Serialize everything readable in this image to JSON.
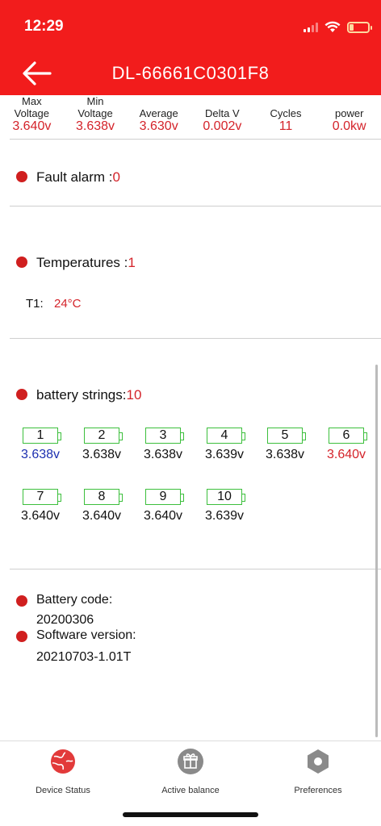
{
  "status_bar": {
    "time": "12:29"
  },
  "header": {
    "title": "DL-66661C0301F8"
  },
  "summary": [
    {
      "label": "Max\nVoltage",
      "value": "3.640v"
    },
    {
      "label": "Min\nVoltage",
      "value": "3.638v"
    },
    {
      "label": "Average",
      "value": "3.630v"
    },
    {
      "label": "Delta V",
      "value": "0.002v"
    },
    {
      "label": "Cycles",
      "value": "11"
    },
    {
      "label": "power",
      "value": "0.0kw"
    }
  ],
  "fault": {
    "label": "Fault alarm :",
    "value": "0"
  },
  "temperatures": {
    "label": "Temperatures :",
    "count": "1",
    "t1_label": "T1:",
    "t1_value": "24°C"
  },
  "battery_strings": {
    "label": "battery strings:",
    "count": "10",
    "cells": [
      {
        "num": "1",
        "voltage": "3.638v",
        "state": "low"
      },
      {
        "num": "2",
        "voltage": "3.638v",
        "state": "normal"
      },
      {
        "num": "3",
        "voltage": "3.638v",
        "state": "normal"
      },
      {
        "num": "4",
        "voltage": "3.639v",
        "state": "normal"
      },
      {
        "num": "5",
        "voltage": "3.638v",
        "state": "normal"
      },
      {
        "num": "6",
        "voltage": "3.640v",
        "state": "high"
      },
      {
        "num": "7",
        "voltage": "3.640v",
        "state": "normal"
      },
      {
        "num": "8",
        "voltage": "3.640v",
        "state": "normal"
      },
      {
        "num": "9",
        "voltage": "3.640v",
        "state": "normal"
      },
      {
        "num": "10",
        "voltage": "3.639v",
        "state": "normal"
      }
    ]
  },
  "info": {
    "battery_code_label": "Battery code:",
    "battery_code": "20200306",
    "software_version_label": "Software version:",
    "software_version": "20210703-1.01T"
  },
  "tabs": [
    {
      "label": "Device Status",
      "icon": "globe-icon",
      "color": "#e23a3a"
    },
    {
      "label": "Active balance",
      "icon": "gift-icon",
      "color": "#8a8a8a"
    },
    {
      "label": "Preferences",
      "icon": "gear-icon",
      "color": "#8a8a8a"
    }
  ],
  "colors": {
    "header": "#f21c1c",
    "accent_red": "#d4232a",
    "cell_border": "#3cbf3c",
    "low_voltage": "#1c2fb0"
  }
}
